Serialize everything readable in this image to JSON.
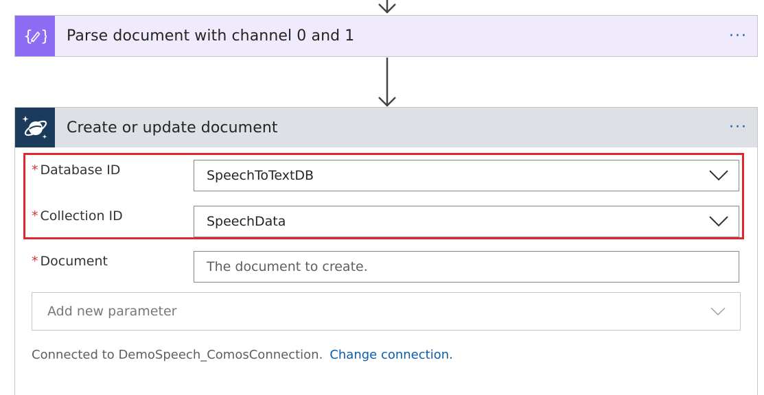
{
  "parse_card": {
    "title": "Parse document with channel 0 and 1",
    "icon": "data-operation-icon",
    "more": "···",
    "icon_color": "#8c6cf2",
    "header_bg": "#efeafc"
  },
  "cosmos_card": {
    "title": "Create or update document",
    "icon": "cosmos-db-planet-icon",
    "more": "···",
    "icon_color": "#1b3b5c",
    "header_bg": "#dde1e6",
    "fields": {
      "database": {
        "required_mark": "*",
        "label": "Database ID",
        "value": "SpeechToTextDB"
      },
      "collection": {
        "required_mark": "*",
        "label": "Collection ID",
        "value": "SpeechData"
      },
      "document": {
        "required_mark": "*",
        "label": "Document",
        "placeholder": "The document to create."
      }
    },
    "add_parameter": "Add new parameter",
    "connection_text": "Connected to DemoSpeech_ComosConnection.",
    "change_connection": "Change connection."
  },
  "highlight_color": "#e0262f",
  "link_color": "#0b5cad"
}
